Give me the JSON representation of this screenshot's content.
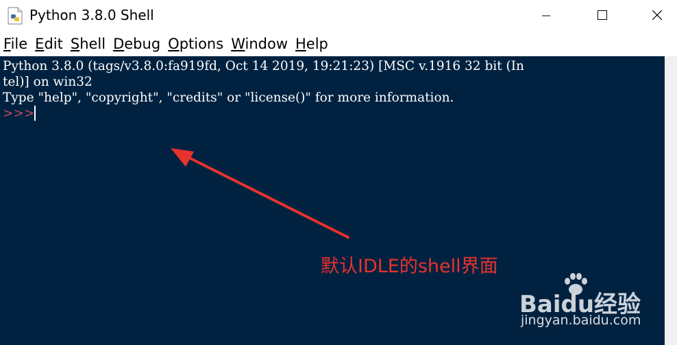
{
  "window": {
    "title": "Python 3.8.0 Shell",
    "icon": "python-idle-icon"
  },
  "menu": [
    {
      "label": "File",
      "mnemonic": "F",
      "rest": "ile"
    },
    {
      "label": "Edit",
      "mnemonic": "E",
      "rest": "dit"
    },
    {
      "label": "Shell",
      "mnemonic": "S",
      "rest": "hell"
    },
    {
      "label": "Debug",
      "mnemonic": "D",
      "rest": "ebug"
    },
    {
      "label": "Options",
      "mnemonic": "O",
      "rest": "ptions"
    },
    {
      "label": "Window",
      "mnemonic": "W",
      "rest": "indow"
    },
    {
      "label": "Help",
      "mnemonic": "H",
      "rest": "elp"
    }
  ],
  "shell": {
    "lines": [
      "Python 3.8.0 (tags/v3.8.0:fa919fd, Oct 14 2019, 19:21:23) [MSC v.1916 32 bit (In",
      "tel)] on win32",
      "Type \"help\", \"copyright\", \"credits\" or \"license()\" for more information."
    ],
    "prompt": ">>>"
  },
  "annotation": {
    "text": "默认IDLE的shell界面",
    "color": "#e8322d"
  },
  "watermark": {
    "brand": "Baidu经验",
    "url": "jingyan.baidu.com"
  },
  "colors": {
    "shell_background": "#002240",
    "shell_text": "#ffffff",
    "prompt": "#c0505a"
  }
}
